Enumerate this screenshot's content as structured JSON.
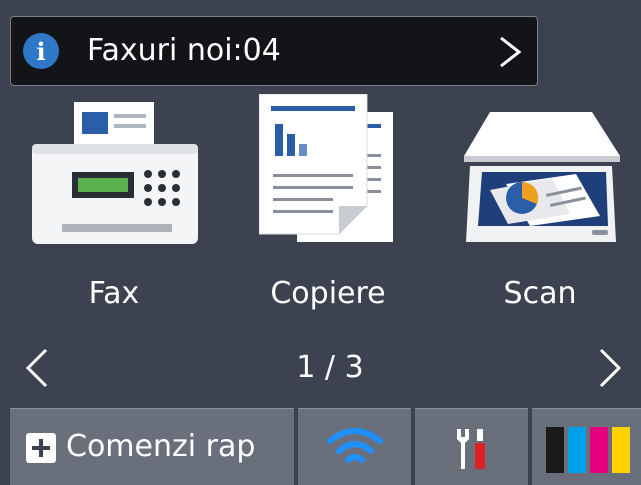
{
  "notification": {
    "icon": "info-icon",
    "text": "Faxuri noi:04",
    "chevron": "chevron-right-icon"
  },
  "tiles": [
    {
      "label": "Fax",
      "icon": "fax-machine-icon"
    },
    {
      "label": "Copiere",
      "icon": "copy-documents-icon"
    },
    {
      "label": "Scan",
      "icon": "scanner-icon"
    }
  ],
  "pager": {
    "text": "1 / 3",
    "prev_icon": "chevron-left-icon",
    "next_icon": "chevron-right-icon"
  },
  "bottom_bar": {
    "shortcuts_label": "Comenzi rap",
    "shortcuts_icon": "plus-icon",
    "wifi_icon": "wifi-icon",
    "tools_icon": "tools-icon",
    "ink_icon": "ink-cartridges-icon"
  },
  "colors": {
    "background": "#3c4250",
    "button": "#69707c",
    "notification_bg": "#121417",
    "info_blue": "#2f78c8",
    "wifi_blue": "#1e90ff",
    "ink_black": "#1a1a1a",
    "ink_cyan": "#00a0e8",
    "ink_magenta": "#e4007f",
    "ink_yellow": "#ffd200"
  }
}
